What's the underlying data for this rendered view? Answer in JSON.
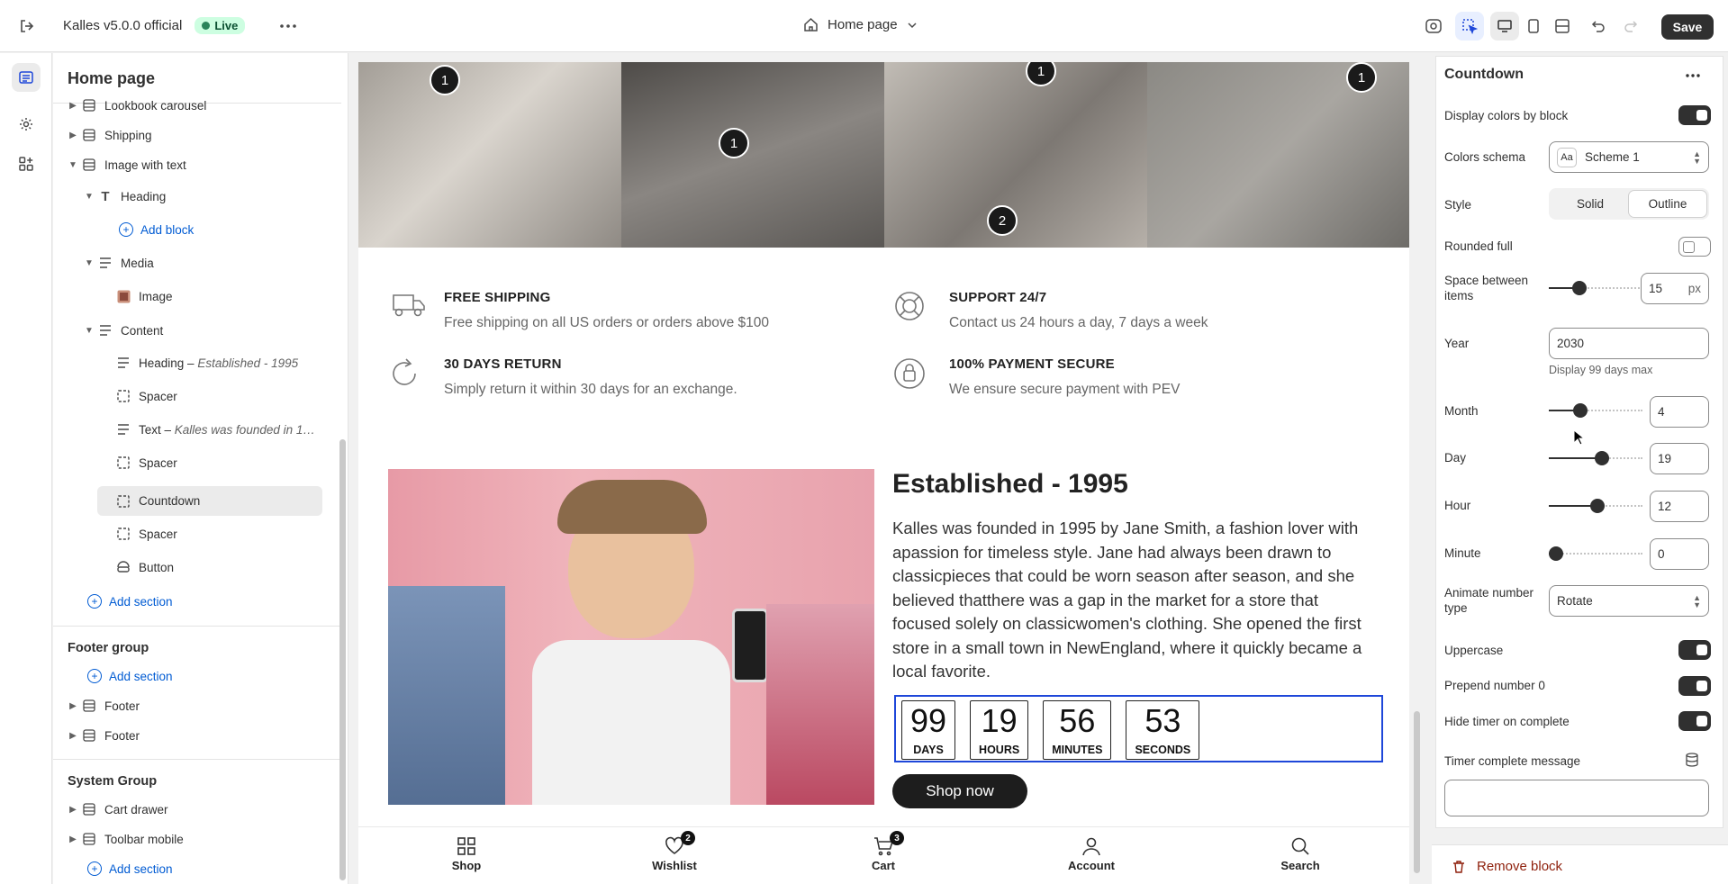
{
  "topbar": {
    "store_name": "Kalles v5.0.0 official",
    "status": "Live",
    "page_selector": "Home page",
    "save_label": "Save"
  },
  "sidebar": {
    "title": "Home page",
    "items": [
      {
        "label": "Lookbook carousel"
      },
      {
        "label": "Shipping"
      },
      {
        "label": "Image with text"
      },
      {
        "label": "Heading"
      },
      {
        "label": "Add block"
      },
      {
        "label": "Media"
      },
      {
        "label": "Image"
      },
      {
        "label": "Content"
      },
      {
        "label": "Heading",
        "detail": "Established - 1995"
      },
      {
        "label": "Spacer"
      },
      {
        "label": "Text",
        "detail": "Kalles was founded in 1…"
      },
      {
        "label": "Spacer"
      },
      {
        "label": "Countdown"
      },
      {
        "label": "Spacer"
      },
      {
        "label": "Button"
      },
      {
        "label": "Add section"
      }
    ],
    "footer_group": {
      "title": "Footer group",
      "items": [
        "Add section",
        "Footer",
        "Footer"
      ]
    },
    "system_group": {
      "title": "System Group",
      "items": [
        "Cart drawer",
        "Toolbar mobile",
        "Add section"
      ]
    }
  },
  "preview": {
    "hotspots": [
      "1",
      "1",
      "1",
      "1",
      "2"
    ],
    "features": [
      {
        "title": "FREE SHIPPING",
        "desc": "Free shipping on all US orders or orders above $100"
      },
      {
        "title": "SUPPORT 24/7",
        "desc": "Contact us 24 hours a day, 7 days a week"
      },
      {
        "title": "30 DAYS RETURN",
        "desc": "Simply return it within 30 days for an exchange."
      },
      {
        "title": "100% PAYMENT SECURE",
        "desc": "We ensure secure payment with PEV"
      }
    ],
    "heading": "Established - 1995",
    "body": "Kalles was founded in 1995 by Jane Smith, a fashion lover with apassion for timeless style. Jane had always been drawn to classicpieces that could be worn season after season, and she believed thatthere was a gap in the market for a store that focused solely on classicwomen's clothing. She opened the first store in a small town in NewEngland, where it quickly became a local favorite.",
    "countdown": [
      {
        "value": "99",
        "unit": "DAYS"
      },
      {
        "value": "19",
        "unit": "HOURS"
      },
      {
        "value": "56",
        "unit": "MINUTES"
      },
      {
        "value": "53",
        "unit": "SECONDS"
      }
    ],
    "button": "Shop now",
    "bottom_nav": [
      {
        "label": "Shop",
        "badge": ""
      },
      {
        "label": "Wishlist",
        "badge": "2"
      },
      {
        "label": "Cart",
        "badge": "3"
      },
      {
        "label": "Account",
        "badge": ""
      },
      {
        "label": "Search",
        "badge": ""
      }
    ]
  },
  "settings": {
    "title": "Countdown",
    "display_colors_label": "Display colors by block",
    "display_colors": true,
    "colors_schema_label": "Colors schema",
    "colors_schema": "Scheme 1",
    "style_label": "Style",
    "style_options": [
      "Solid",
      "Outline"
    ],
    "style_selected": "Outline",
    "rounded_label": "Rounded full",
    "rounded": false,
    "space_label": "Space between items",
    "space_value": "15",
    "space_unit": "px",
    "space_fraction": 0.3,
    "year_label": "Year",
    "year_value": "2030",
    "year_hint": "Display 99 days max",
    "month_label": "Month",
    "month_value": "4",
    "month_fraction": 0.31,
    "day_label": "Day",
    "day_value": "19",
    "day_fraction": 0.58,
    "hour_label": "Hour",
    "hour_value": "12",
    "hour_fraction": 0.52,
    "minute_label": "Minute",
    "minute_value": "0",
    "minute_fraction": 0.0,
    "animate_label": "Animate number type",
    "animate_value": "Rotate",
    "uppercase_label": "Uppercase",
    "uppercase": true,
    "prepend_label": "Prepend number 0",
    "prepend": true,
    "hide_timer_label": "Hide timer on complete",
    "hide_timer": true,
    "complete_msg_label": "Timer complete message",
    "complete_msg_value": "",
    "remove_label": "Remove block"
  }
}
